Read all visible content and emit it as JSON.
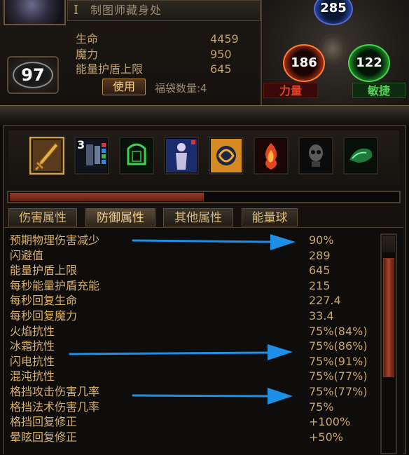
{
  "character": {
    "location_name": "制图师藏身处",
    "level": "97",
    "stats": [
      {
        "label": "生命",
        "value": "4459"
      },
      {
        "label": "魔力",
        "value": "950"
      },
      {
        "label": "能量护盾上限",
        "value": "645"
      }
    ],
    "use_button": "使用",
    "bag_count": "福袋数量:4"
  },
  "attributes": {
    "intelligence": "285",
    "strength": "186",
    "dexterity": "122",
    "strength_label": "力量",
    "dexterity_label": "敏捷"
  },
  "skill_bar": {
    "slot_count_label": "3",
    "active_slot": 0,
    "progress_fraction": 0.5
  },
  "tabs": [
    "伤害属性",
    "防御属性",
    "其他属性",
    "能量球"
  ],
  "active_tab": 1,
  "defense_stats": [
    {
      "label": "预期物理伤害减少",
      "value": "90%"
    },
    {
      "label": "闪避值",
      "value": "289"
    },
    {
      "label": "能量护盾上限",
      "value": "645"
    },
    {
      "label": "每秒能量护盾充能",
      "value": "215"
    },
    {
      "label": "每秒回复生命",
      "value": "227.4"
    },
    {
      "label": "每秒回复魔力",
      "value": "33.4"
    },
    {
      "label": "火焰抗性",
      "value": "75%(84%)"
    },
    {
      "label": "冰霜抗性",
      "value": "75%(86%)"
    },
    {
      "label": "闪电抗性",
      "value": "75%(91%)"
    },
    {
      "label": "混沌抗性",
      "value": "75%(77%)"
    },
    {
      "label": "格挡攻击伤害几率",
      "value": "75%(77%)"
    },
    {
      "label": "格挡法术伤害几率",
      "value": "75%"
    },
    {
      "label": "格挡回复修正",
      "value": "+100%"
    },
    {
      "label": "晕眩回复修正",
      "value": "+50%"
    }
  ],
  "colors": {
    "accent": "#d9b06a",
    "arrow": "#1e8fe6",
    "strength": "#e0442c",
    "dexterity": "#51d150",
    "intelligence": "#506ad0"
  },
  "icons": [
    "sword-icon",
    "totem-gem-icon",
    "green-armor-icon",
    "spectral-figure-icon",
    "fire-orb-icon",
    "flame-fist-icon",
    "shadow-skull-icon",
    "green-beast-icon"
  ]
}
